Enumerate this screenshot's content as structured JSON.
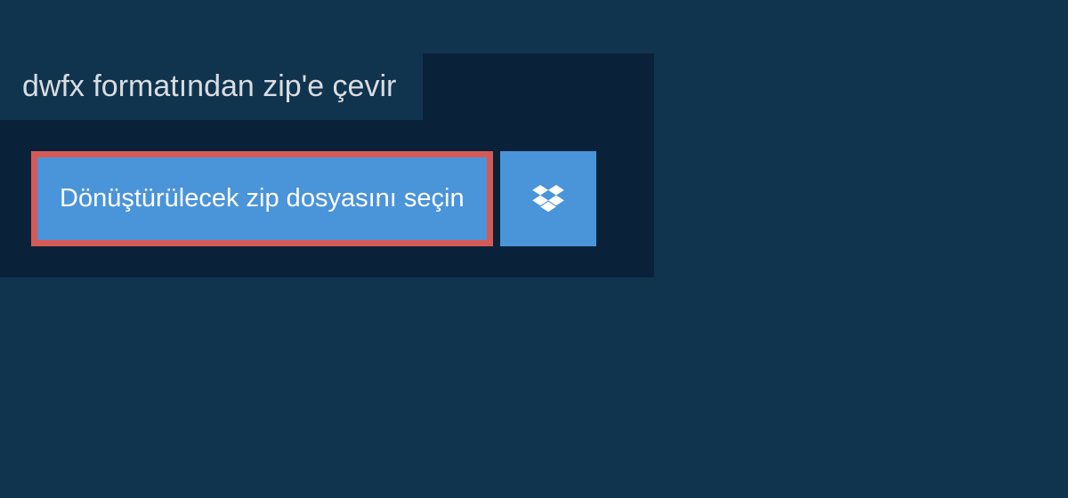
{
  "header": {
    "title": "dwfx formatından zip'e çevir"
  },
  "actions": {
    "select_file_label": "Dönüştürülecek zip dosyasını seçin",
    "dropbox_icon": "dropbox-icon"
  },
  "colors": {
    "bg_outer": "#11344e",
    "bg_panel": "#0a2239",
    "button_bg": "#4a94da",
    "button_border": "#d55a56",
    "text_light": "#d8dde2",
    "text_white": "#ffffff"
  }
}
